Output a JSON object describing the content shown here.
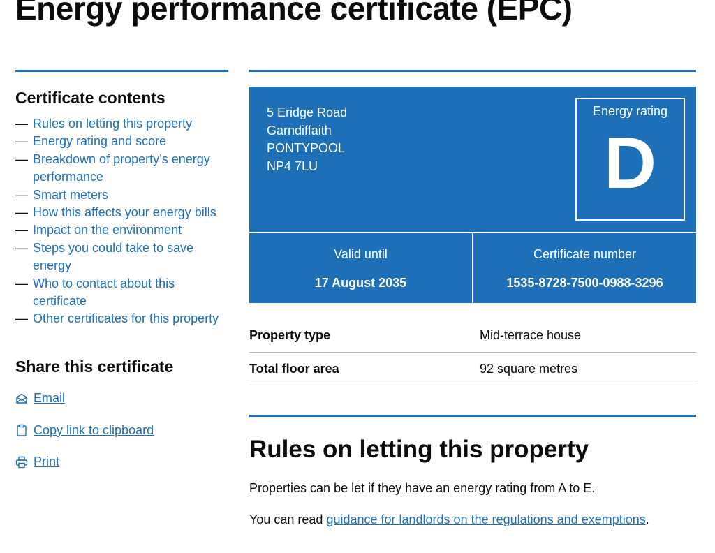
{
  "page": {
    "title": "Energy performance certificate (EPC)"
  },
  "colors": {
    "accent": "#1d70b8",
    "text": "#0b0c0c",
    "divider": "#b1b4b6"
  },
  "sidebar": {
    "contents_title": "Certificate contents",
    "dash": "—",
    "items": [
      {
        "label": "Rules on letting this property"
      },
      {
        "label": "Energy rating and score"
      },
      {
        "label": "Breakdown of property’s energy performance"
      },
      {
        "label": "Smart meters"
      },
      {
        "label": "How this affects your energy bills"
      },
      {
        "label": "Impact on the environment"
      },
      {
        "label": "Steps you could take to save energy"
      },
      {
        "label": "Who to contact about this certificate"
      },
      {
        "label": "Other certificates for this property"
      }
    ],
    "share_title": "Share this certificate",
    "share": [
      {
        "label": "Email",
        "icon": "email-icon"
      },
      {
        "label": "Copy link to clipboard",
        "icon": "clipboard-icon"
      },
      {
        "label": "Print",
        "icon": "printer-icon"
      }
    ]
  },
  "certificate": {
    "address": [
      "5 Eridge Road",
      "Garndiffaith",
      "PONTYPOOL",
      "NP4 7LU"
    ],
    "rating_label": "Energy rating",
    "rating": "D",
    "valid_until_label": "Valid until",
    "valid_until": "17 August 2035",
    "number_label": "Certificate number",
    "number": "1535-8728-7500-0988-3296"
  },
  "summary": [
    {
      "key": "Property type",
      "value": "Mid-terrace house"
    },
    {
      "key": "Total floor area",
      "value": "92 square metres"
    }
  ],
  "rules": {
    "title": "Rules on letting this property",
    "para1": "Properties can be let if they have an energy rating from A to E.",
    "para2_prefix": "You can read ",
    "para2_link": "guidance for landlords on the regulations and exemptions",
    "para2_suffix": "."
  }
}
